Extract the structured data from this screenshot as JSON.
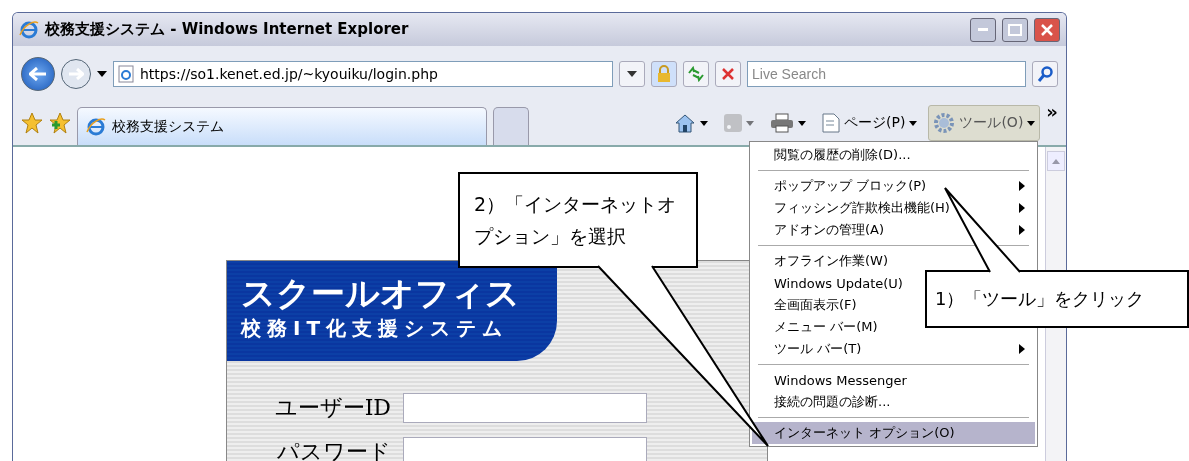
{
  "window": {
    "title": "校務支援システム - Windows Internet Explorer"
  },
  "address_bar": {
    "url": "https://so1.kenet.ed.jp/~kyouiku/login.php"
  },
  "search": {
    "placeholder": "Live Search"
  },
  "tabs": [
    {
      "label": "校務支援システム",
      "selected": true
    }
  ],
  "command_bar": [
    {
      "kind": "icon",
      "disabled": false,
      "selected": false
    },
    {
      "kind": "icon",
      "disabled": true,
      "selected": false
    },
    {
      "kind": "icon",
      "disabled": false,
      "selected": false
    },
    {
      "kind": "text",
      "label": "ページ(P)",
      "disabled": false,
      "selected": false
    },
    {
      "kind": "text",
      "label": "ツール(O)",
      "disabled": false,
      "selected": true
    }
  ],
  "overflow": "»",
  "login": {
    "logo": "スクールオフィス",
    "subtitle": "校務IT化支援システム",
    "fields": [
      {
        "label": "ユーザーID"
      },
      {
        "label": "パスワード"
      }
    ]
  },
  "tools_menu": [
    [
      {
        "label": "閲覧の履歴の削除(D)...",
        "submenu": false,
        "selected": false
      }
    ],
    [
      {
        "label": "ポップアップ ブロック(P)",
        "submenu": true,
        "selected": false
      },
      {
        "label": "フィッシング詐欺検出機能(H)",
        "submenu": true,
        "selected": false
      },
      {
        "label": "アドオンの管理(A)",
        "submenu": true,
        "selected": false
      }
    ],
    [
      {
        "label": "オフライン作業(W)",
        "submenu": false,
        "selected": false
      },
      {
        "label": "Windows Update(U)",
        "selected": false
      },
      {
        "label": "全画面表示(F)",
        "selected": false
      },
      {
        "label": "メニュー バー(M)",
        "submenu": false,
        "selected": false
      },
      {
        "label": "ツール バー(T)",
        "submenu": true,
        "selected": false
      }
    ],
    [
      {
        "label": "Windows Messenger",
        "submenu": false,
        "selected": false
      },
      {
        "label": "接続の問題の診断...",
        "submenu": false,
        "selected": false
      }
    ],
    [
      {
        "label": "インターネット オプション(O)",
        "submenu": false,
        "selected": true
      }
    ]
  ],
  "callouts": [
    {
      "text": "1）「ツール」をクリック"
    },
    {
      "text": "2）「インターネットオプション」を選択"
    }
  ]
}
